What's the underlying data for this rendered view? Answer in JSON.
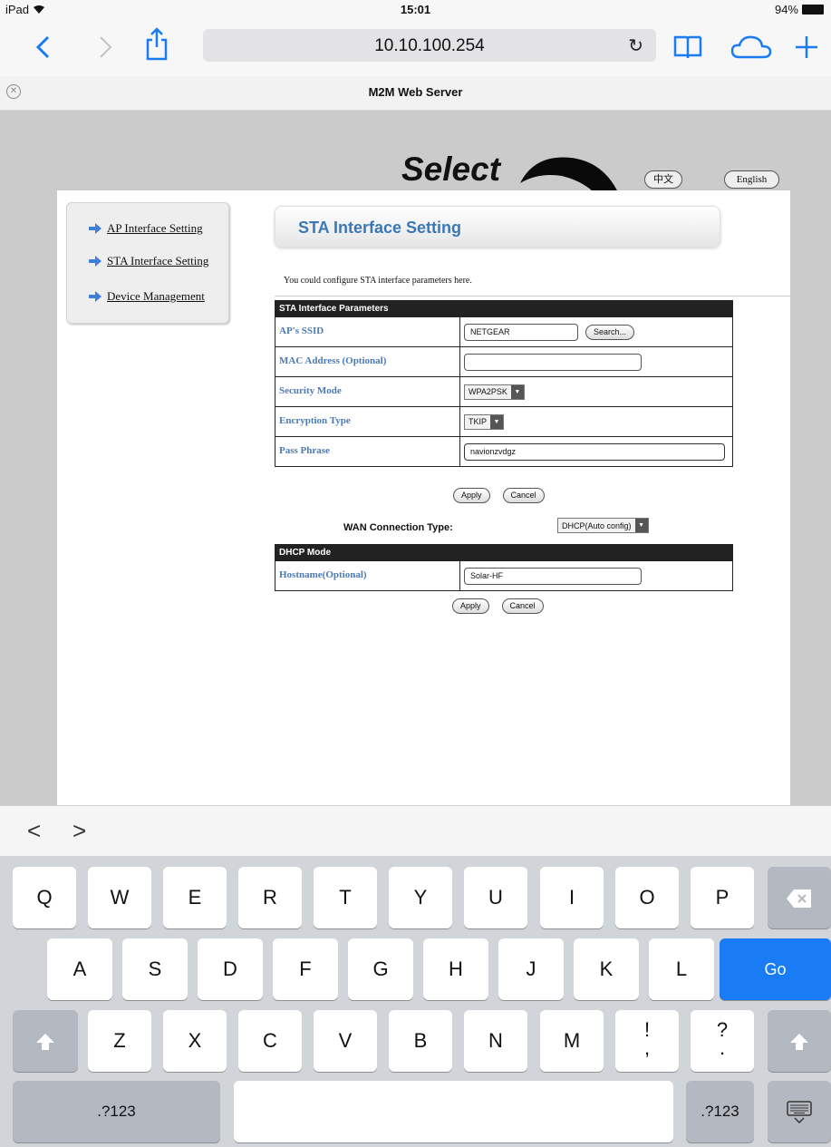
{
  "status_bar": {
    "device": "iPad",
    "wifi_icon": "wifi-icon",
    "time": "15:01",
    "battery": "94%",
    "battery_level": 0.94
  },
  "toolbar": {
    "url": "10.10.100.254",
    "icons": [
      "back-icon",
      "forward-icon",
      "share-icon",
      "reload-icon",
      "bookmarks-icon",
      "cloud-tabs-icon",
      "new-tab-icon"
    ]
  },
  "tab": {
    "title": "M2M Web Server"
  },
  "page": {
    "lang_buttons": [
      "中文",
      "English"
    ],
    "annotation": "Select",
    "nav": [
      "AP Interface Setting",
      "STA Interface Setting",
      "Device Management"
    ],
    "section_title": "STA Interface Setting",
    "description": "You could configure STA interface parameters here.",
    "sta_params": {
      "header": "STA Interface Parameters",
      "rows": [
        {
          "label": "AP's SSID",
          "value": "NETGEAR",
          "button": "Search..."
        },
        {
          "label": "MAC Address (Optional)",
          "value": ""
        },
        {
          "label": "Security Mode",
          "value": "WPA2PSK"
        },
        {
          "label": "Encryption Type",
          "value": "TKIP"
        },
        {
          "label": "Pass Phrase",
          "value": "navionzvdgz"
        }
      ]
    },
    "apply": "Apply",
    "cancel": "Cancel",
    "wan": {
      "label": "WAN Connection Type:",
      "value": "DHCP(Auto config)"
    },
    "dhcp": {
      "header": "DHCP Mode",
      "rows": [
        {
          "label": "Hostname(Optional)",
          "value": "Solar-HF"
        }
      ]
    }
  },
  "accessory": {
    "prev": "<",
    "next": ">"
  },
  "keyboard": {
    "row1": [
      "Q",
      "W",
      "E",
      "R",
      "T",
      "Y",
      "U",
      "I",
      "O",
      "P"
    ],
    "row2": [
      "A",
      "S",
      "D",
      "F",
      "G",
      "H",
      "J",
      "K",
      "L"
    ],
    "row3": [
      "Z",
      "X",
      "C",
      "V",
      "B",
      "N",
      "M"
    ],
    "punct1": [
      "!",
      ","
    ],
    "punct2": [
      "?",
      "."
    ],
    "go": "Go",
    "numbers": ".?123",
    "icons": [
      "delete-icon",
      "shift-icon",
      "hide-keyboard-icon"
    ]
  },
  "colors": {
    "ios_blue": "#1a7cf5",
    "label_blue": "#4a7cb5",
    "title_blue": "#3a78b8",
    "page_gray": "#cbcbcb",
    "keyboard_bg": "#d1d4d9"
  }
}
